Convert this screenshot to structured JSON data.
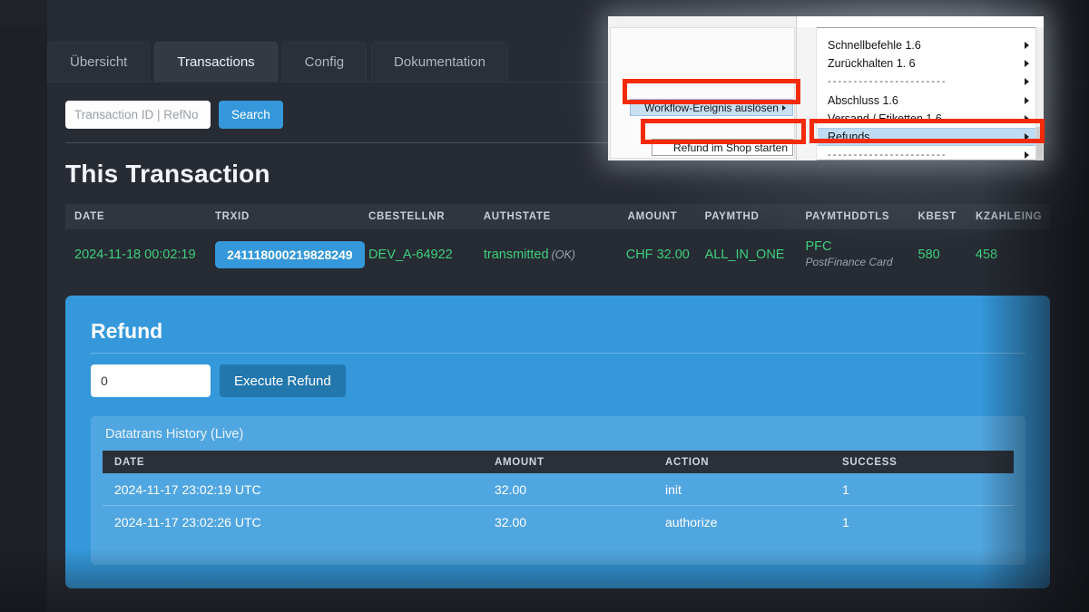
{
  "tabs": [
    {
      "label": "Übersicht",
      "active": false
    },
    {
      "label": "Transactions",
      "active": true
    },
    {
      "label": "Config",
      "active": false
    },
    {
      "label": "Dokumentation",
      "active": false
    }
  ],
  "search": {
    "placeholder": "Transaction ID | RefNo",
    "value": "",
    "button_label": "Search"
  },
  "page_title": "This Transaction",
  "transaction_table": {
    "columns": [
      "DATE",
      "TRXID",
      "CBESTELLNR",
      "AUTHSTATE",
      "AMOUNT",
      "PAYMTHD",
      "PAYMTHDDTLS",
      "KBEST",
      "KZAHLEING"
    ],
    "row": {
      "date": "2024-11-18 00:02:19",
      "trxid": "241118000219828249",
      "cbestellnr": "DEV_A-64922",
      "authstate": "transmitted",
      "authstate_note": "(OK)",
      "amount": "CHF 32.00",
      "paymthd": "ALL_IN_ONE",
      "paymthddtls": "PFC",
      "paymthddtls_sub": "PostFinance Card",
      "kbest": "580",
      "kzahleing": "458"
    }
  },
  "refund": {
    "title": "Refund",
    "amount_value": "0",
    "amount_placeholder": "0",
    "execute_label": "Execute Refund",
    "history_title": "Datatrans History (Live)",
    "history_columns": [
      "DATE",
      "AMOUNT",
      "ACTION",
      "SUCCESS"
    ],
    "history_rows": [
      {
        "date": "2024-11-17 23:02:19 UTC",
        "amount": "32.00",
        "action": "init",
        "success": "1"
      },
      {
        "date": "2024-11-17 23:02:26 UTC",
        "amount": "32.00",
        "action": "authorize",
        "success": "1"
      }
    ]
  },
  "overlay_menu": {
    "left_submenu_workflow": "Workflow-Ereignis auslösen",
    "left_submenu_refund": "Refund im Shop starten",
    "items": [
      {
        "label": "Schnellbefehle 1.6",
        "highlighted": false,
        "separator": false
      },
      {
        "label": "Zurückhalten 1. 6",
        "highlighted": false,
        "separator": false
      },
      {
        "label": "- - - - - - - - - - - - - - - - - - - - - - -",
        "highlighted": false,
        "separator": true
      },
      {
        "label": "Abschluss 1.6",
        "highlighted": false,
        "separator": false
      },
      {
        "label": "Versand / Etiketten 1.6",
        "highlighted": false,
        "separator": false
      },
      {
        "label": "Refunds",
        "highlighted": true,
        "separator": false
      },
      {
        "label": "- - - - - - - - - - - - - - - - - - - - - - -",
        "highlighted": false,
        "separator": true
      }
    ]
  },
  "colors": {
    "accent_blue": "#3498db",
    "panel_dark": "#272b33",
    "green_text": "#3ecf7e",
    "annotation_red": "#f42b0a",
    "button_dark_blue": "#2277ad"
  }
}
